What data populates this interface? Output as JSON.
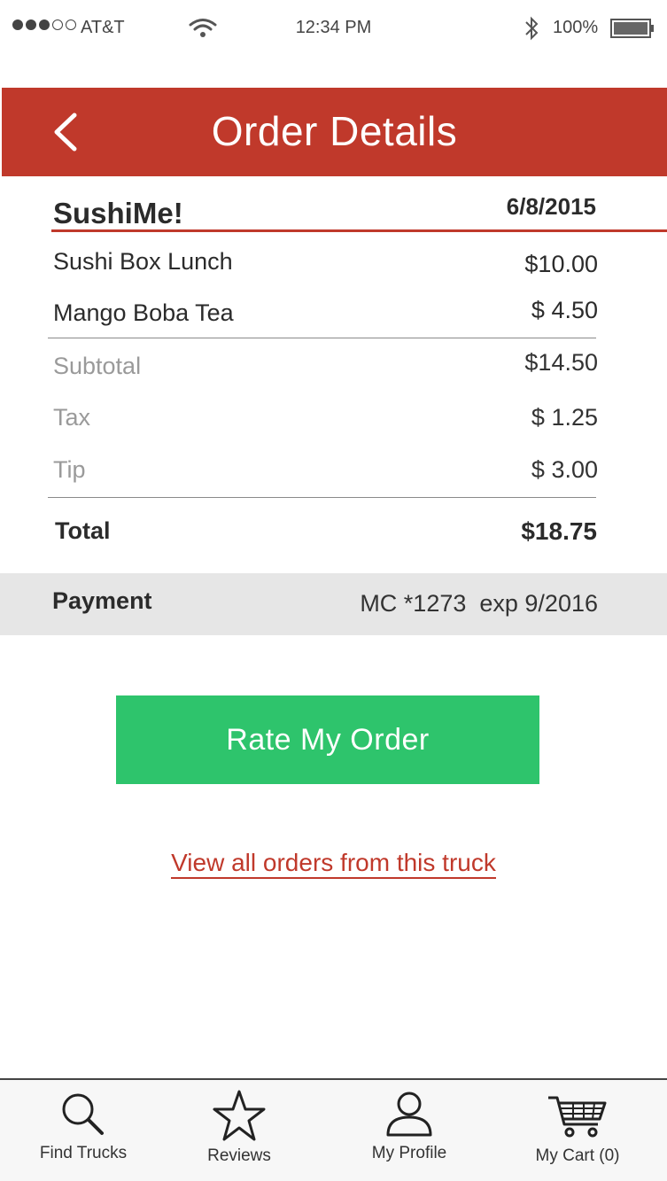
{
  "status_bar": {
    "carrier": "AT&T",
    "time": "12:34 PM",
    "battery": "100%"
  },
  "header": {
    "title": "Order Details"
  },
  "order": {
    "truck_name": "SushiMe!",
    "date": "6/8/2015",
    "items": [
      {
        "name": "Sushi Box Lunch",
        "price": "$10.00"
      },
      {
        "name": "Mango Boba Tea",
        "price": "$ 4.50"
      }
    ],
    "subtotal_label": "Subtotal",
    "subtotal": "$14.50",
    "tax_label": "Tax",
    "tax": "$ 1.25",
    "tip_label": "Tip",
    "tip": "$ 3.00",
    "total_label": "Total",
    "total": "$18.75"
  },
  "payment": {
    "label": "Payment",
    "value": "MC *1273  exp 9/2016"
  },
  "actions": {
    "rate_label": "Rate My Order",
    "view_orders_link": "View all orders from this truck"
  },
  "tab_bar": {
    "tabs": [
      {
        "label": "Find Trucks",
        "icon": "search-icon"
      },
      {
        "label": "Reviews",
        "icon": "star-icon"
      },
      {
        "label": "My Profile",
        "icon": "user-icon"
      },
      {
        "label": "My Cart (0)",
        "icon": "cart-icon"
      }
    ]
  },
  "colors": {
    "brand_red": "#c0392b",
    "accent_green": "#2ec46c",
    "payment_band": "#e6e6e6"
  }
}
